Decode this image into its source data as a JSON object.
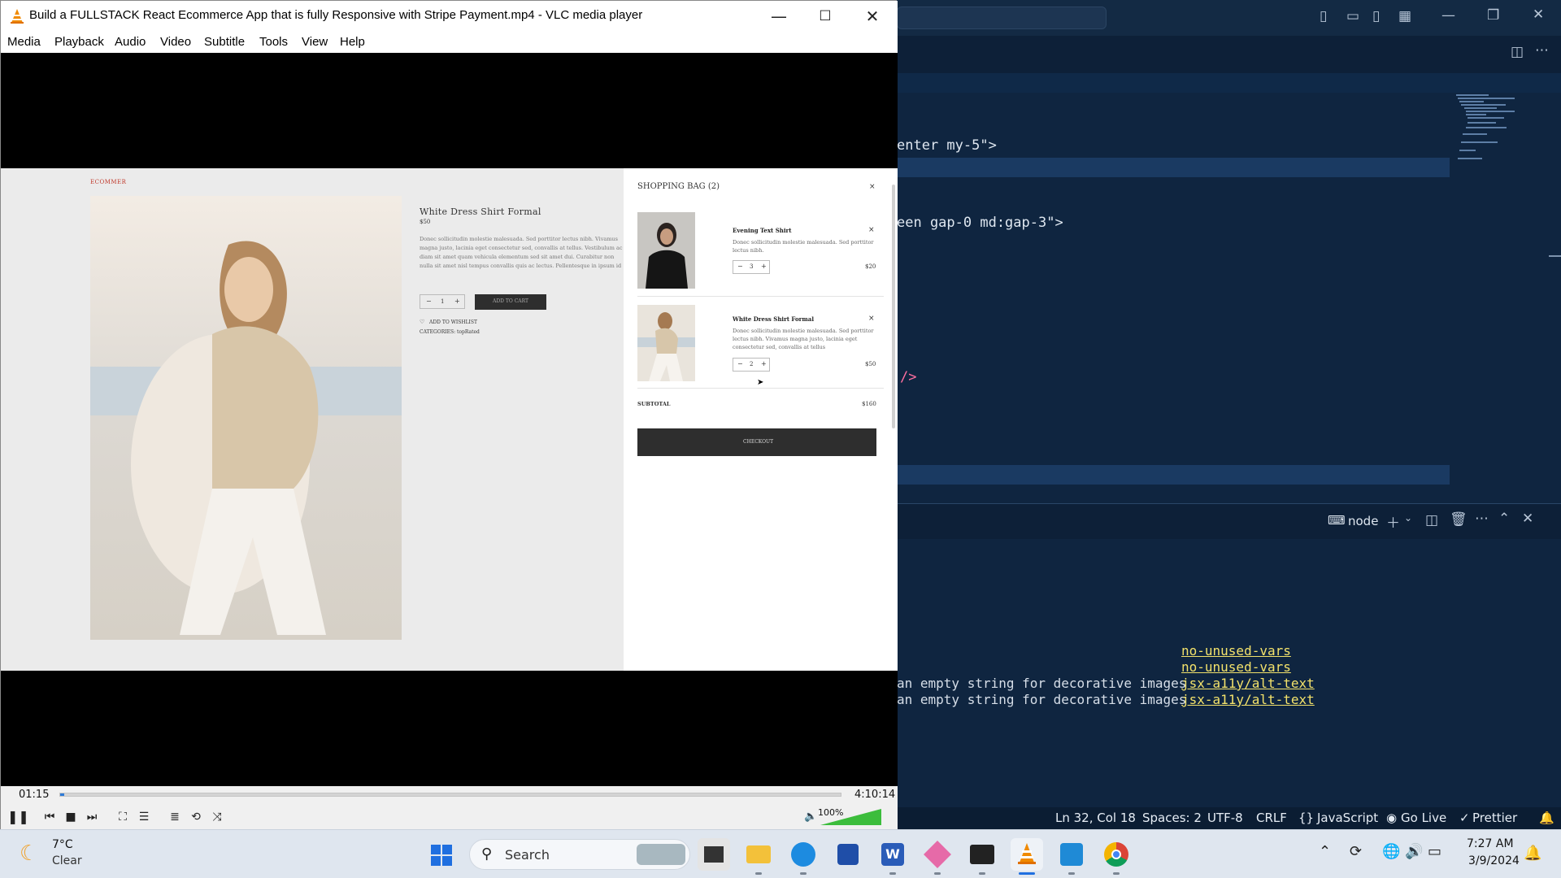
{
  "vscode": {
    "code_lines": [
      {
        "text": "enter my-5\">"
      },
      {
        "text": "een gap-0 md:gap-3\">"
      },
      {
        "text": "/>"
      }
    ],
    "terminal": {
      "shell_label": "node",
      "lines": [
        {
          "text": "",
          "link": "no-unused-vars"
        },
        {
          "text": "",
          "link": "no-unused-vars"
        },
        {
          "text": "an empty string for decorative images",
          "link": "jsx-a11y/alt-text"
        },
        {
          "text": "an empty string for decorative images",
          "link": "jsx-a11y/alt-text"
        }
      ]
    },
    "statusbar": {
      "position": "Ln 32, Col 18",
      "spaces": "Spaces: 2",
      "encoding": "UTF-8",
      "eol": "CRLF",
      "language": "JavaScript",
      "golive": "Go Live",
      "prettier": "Prettier"
    }
  },
  "vlc": {
    "title": "Build a FULLSTACK React Ecommerce App that is fully Responsive with Stripe Payment.mp4 - VLC media player",
    "menu": [
      "Media",
      "Playback",
      "Audio",
      "Video",
      "Subtitle",
      "Tools",
      "View",
      "Help"
    ],
    "time_current": "01:15",
    "time_total": "4:10:14",
    "progress": 0.005,
    "volume_label": "100%",
    "volume": 1.0,
    "video": {
      "brand": "ECOMMER",
      "product_title": "White Dress Shirt Formal",
      "product_price": "$50",
      "product_desc": "Donec sollicitudin molestie malesuada. Sed porttitor lectus nibh. Vivamus magna justo, lacinia eget consectetur sed, convallis at tellus. Vestibulum ac diam sit amet quam vehicula elementum sed sit amet dui. Curabitur non nulla sit amet nisl tempus convallis quis ac lectus. Pellentesque in ipsum id orci porta dapibus. Nulla porttitor accumsan tincidunt. Vestibulum ante ipsum primis in faucibus orci luctus et ultrices posuere cubilia Curae; Donec velit neque, auctor sit amet aliquam vel, ullamcorper sit amet ligula. Vestibulum ac diam sit amet quam vehicula elementum sed sit amet dui. Donec rutrum congue leo eget malesuada.",
      "qty": "1",
      "add_to_cart": "ADD TO CART",
      "wishlist": "ADD TO WISHLIST",
      "categories": "CATEGORIES: topRated",
      "bag_title": "SHOPPING BAG (2)",
      "items": [
        {
          "name": "Evening Text Shirt",
          "desc": "Donec sollicitudin molestie malesuada. Sed porttitor lectus nibh.",
          "qty": "3",
          "price": "$20"
        },
        {
          "name": "White Dress Shirt Formal",
          "desc": "Donec sollicitudin molestie malesuada. Sed porttitor lectus nibh. Vivamus magna justo, lacinia eget consectetur sed, convallis at tellus",
          "qty": "2",
          "price": "$50"
        }
      ],
      "subtotal_label": "SUBTOTAL",
      "subtotal_value": "$160",
      "checkout": "CHECKOUT"
    }
  },
  "taskbar": {
    "weather_temp": "7°C",
    "weather_desc": "Clear",
    "search": "Search",
    "time": "7:27 AM",
    "date": "3/9/2024"
  }
}
